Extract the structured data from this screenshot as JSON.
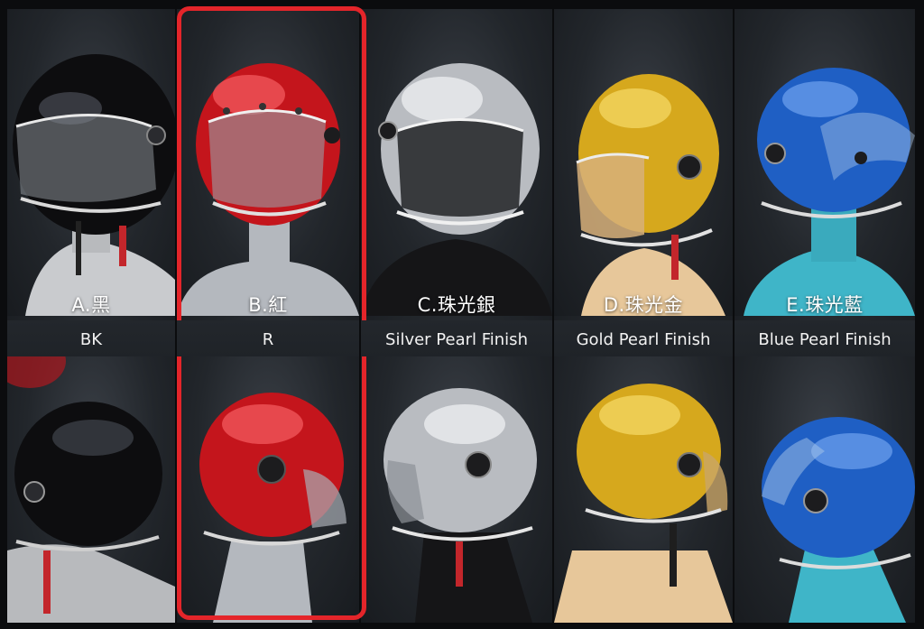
{
  "options": [
    {
      "zh": "A.黑",
      "en": "BK",
      "helmet_color": "#0d0d0f",
      "shine": "#4a4d55",
      "bust_color": "#c9cbce"
    },
    {
      "zh": "B.紅",
      "en": "R",
      "helmet_color": "#c4151c",
      "shine": "#ff6a6e",
      "bust_color": "#b4b8be"
    },
    {
      "zh": "C.珠光銀",
      "en": "Silver Pearl Finish",
      "helmet_color": "#b9bcc1",
      "shine": "#f2f3f5",
      "bust_color": "#151517"
    },
    {
      "zh": "D.珠光金",
      "en": "Gold Pearl Finish",
      "helmet_color": "#d6a81d",
      "shine": "#f7dc6a",
      "bust_color": "#e7c79a"
    },
    {
      "zh": "E.珠光藍",
      "en": "Blue Pearl Finish",
      "helmet_color": "#1f5fc4",
      "shine": "#6fa2f0",
      "bust_color": "#3fb5c8"
    }
  ],
  "selected_option": "B.紅",
  "highlight_color": "#e4252a"
}
